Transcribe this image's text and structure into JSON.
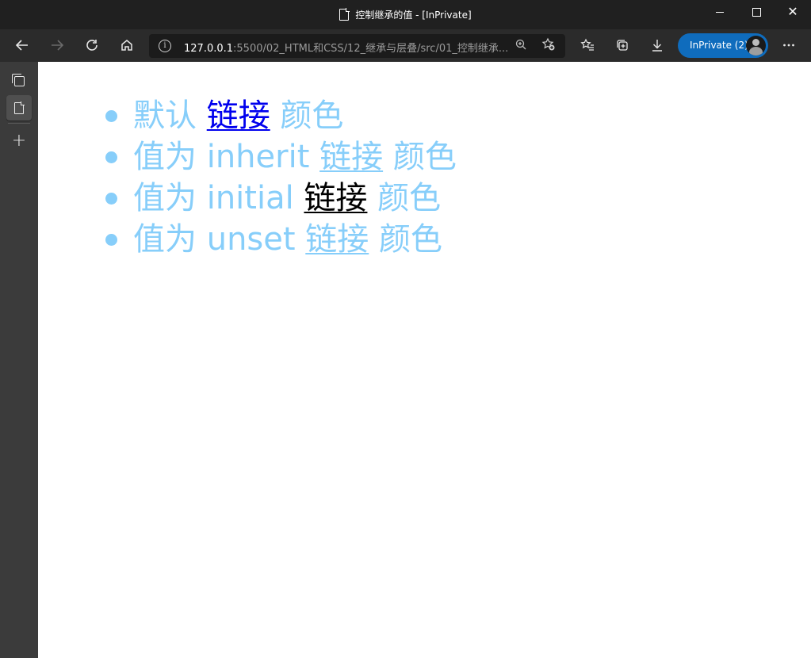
{
  "window": {
    "title": "控制继承的值 - [InPrivate]",
    "controls": {
      "minimize_icon": "minimize-icon",
      "maximize_icon": "maximize-icon",
      "close_icon": "close-icon"
    }
  },
  "toolbar": {
    "back_icon": "back-arrow-icon",
    "forward_icon": "forward-arrow-icon",
    "refresh_icon": "refresh-icon",
    "home_icon": "home-icon",
    "address": {
      "info_icon": "i",
      "host": "127.0.0.1",
      "path": ":5500/02_HTML和CSS/12_继承与层叠/src/01_控制继承..."
    },
    "favorites_label": "InPrivate (2)"
  },
  "sidebar": {
    "items": [
      {
        "name": "tab-actions",
        "icon": "tabs-icon"
      },
      {
        "name": "current-tab",
        "icon": "document-icon"
      },
      {
        "name": "new-tab",
        "icon": "plus-icon"
      }
    ]
  },
  "content": {
    "list": [
      {
        "before": "默认 ",
        "link": "链接",
        "after": " 颜色"
      },
      {
        "before": "值为 inherit ",
        "link": "链接",
        "after": " 颜色"
      },
      {
        "before": "值为 initial ",
        "link": "链接",
        "after": " 颜色"
      },
      {
        "before": "值为 unset ",
        "link": "链接",
        "after": " 颜色"
      }
    ]
  },
  "colors": {
    "text": "#87cefa",
    "link_default": "#0000ee",
    "link_inherit": "#87cefa",
    "link_initial": "#000000",
    "link_unset": "#87cefa",
    "profile_button": "#0f6cbd"
  }
}
